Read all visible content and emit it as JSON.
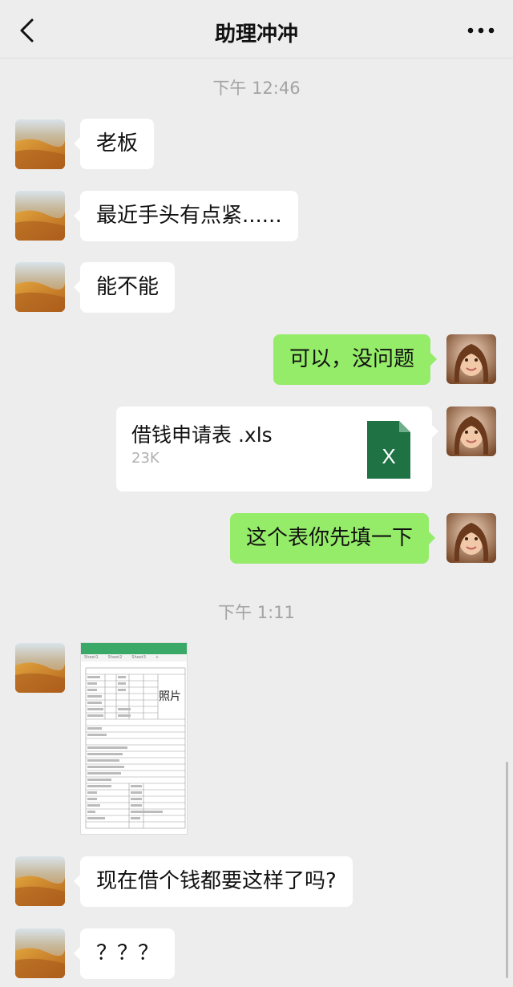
{
  "header": {
    "title": "助理冲冲"
  },
  "messages": {
    "time1": "下午 12:46",
    "m1": "老板",
    "m2": "最近手头有点紧......",
    "m3": "能不能",
    "m4": "可以，没问题",
    "file": {
      "name": "借钱申请表 .xls",
      "size": "23K",
      "icon_letter": "X"
    },
    "m5": "这个表你先填一下",
    "time2": "下午 1:11",
    "sheet": {
      "tabs": [
        "Sheet1",
        "Sheet2",
        "Sheet3",
        "+"
      ],
      "photo_label": "照片"
    },
    "m6": "现在借个钱都要这样了吗?",
    "m7": "？？？"
  },
  "colors": {
    "background": "#ededed",
    "sent_bubble": "#95ec69",
    "received_bubble": "#ffffff",
    "excel_green": "#1f7244"
  },
  "icons": [
    "back-chevron-icon",
    "more-dots-icon",
    "excel-file-icon"
  ]
}
